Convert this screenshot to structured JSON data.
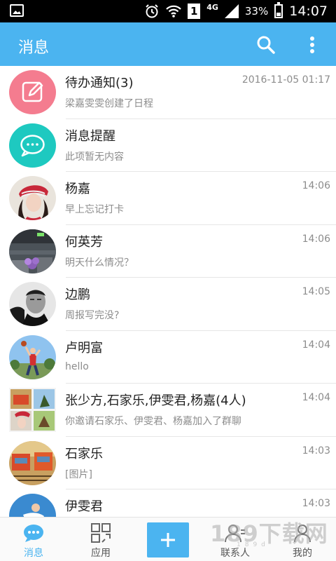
{
  "status_bar": {
    "network": "4G",
    "sim": "1",
    "battery": "33%",
    "time": "14:07"
  },
  "header": {
    "title": "消息"
  },
  "messages": [
    {
      "name": "待办通知(3)",
      "preview": "梁嘉雯雯创建了日程",
      "time": "2016-11-05 01:17",
      "avatar": "todo-icon"
    },
    {
      "name": "消息提醒",
      "preview": "此项暂无内容",
      "time": "",
      "avatar": "chat-bubble-icon"
    },
    {
      "name": "杨嘉",
      "preview": "早上忘记打卡",
      "time": "14:06",
      "avatar": "photo"
    },
    {
      "name": "何英芳",
      "preview": "明天什么情况？",
      "time": "14:06",
      "avatar": "photo"
    },
    {
      "name": "边鹏",
      "preview": "周报写完没?",
      "time": "14:05",
      "avatar": "photo"
    },
    {
      "name": "卢明富",
      "preview": "hello",
      "time": "14:04",
      "avatar": "photo"
    },
    {
      "name": "张少方,石家乐,伊雯君,杨嘉(4人)",
      "preview": "你邀请石家乐、伊雯君、杨嘉加入了群聊",
      "time": "14:04",
      "avatar": "group-photo"
    },
    {
      "name": "石家乐",
      "preview": "[图片]",
      "time": "14:03",
      "avatar": "photo"
    },
    {
      "name": "伊雯君",
      "preview": "",
      "time": "14:03",
      "avatar": "photo"
    }
  ],
  "bottom_nav": {
    "messages": "消息",
    "apps": "应用",
    "contacts": "联系人",
    "me": "我的"
  },
  "watermark": {
    "text": "189下载网",
    "sub": "189d"
  },
  "colors": {
    "accent": "#4bb4f0",
    "todo_avatar": "#f47c8f",
    "reminder_avatar": "#1ec9c0"
  }
}
